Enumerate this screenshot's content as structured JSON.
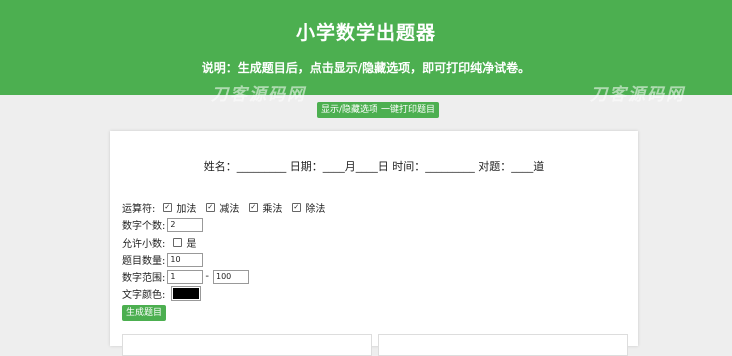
{
  "header": {
    "title": "小学数学出题器",
    "description": "说明：生成题目后，点击显示/隐藏选项，即可打印纯净试卷。",
    "watermark": "刀客源码网"
  },
  "toolbar": {
    "toggle_label": "显示/隐藏选项",
    "print_label": "一键打印题目"
  },
  "info_line": "姓名：_________ 日期：____月____日 时间：_________ 对题：____道",
  "form": {
    "operators_label": "运算符:",
    "operators": [
      {
        "label": "加法",
        "checked": true
      },
      {
        "label": "减法",
        "checked": true
      },
      {
        "label": "乘法",
        "checked": true
      },
      {
        "label": "除法",
        "checked": true
      }
    ],
    "digit_count_label": "数字个数:",
    "digit_count_value": "2",
    "decimal_label": "允许小数:",
    "decimal_option": "是",
    "decimal_checked": false,
    "question_count_label": "题目数量:",
    "question_count_value": "10",
    "range_label": "数字范围:",
    "range_min": "1",
    "range_sep": "-",
    "range_max": "100",
    "text_color_label": "文字颜色:",
    "text_color": "#000000",
    "generate_label": "生成题目"
  },
  "colors": {
    "accent": "#4caf50",
    "background": "#eeeeee"
  }
}
